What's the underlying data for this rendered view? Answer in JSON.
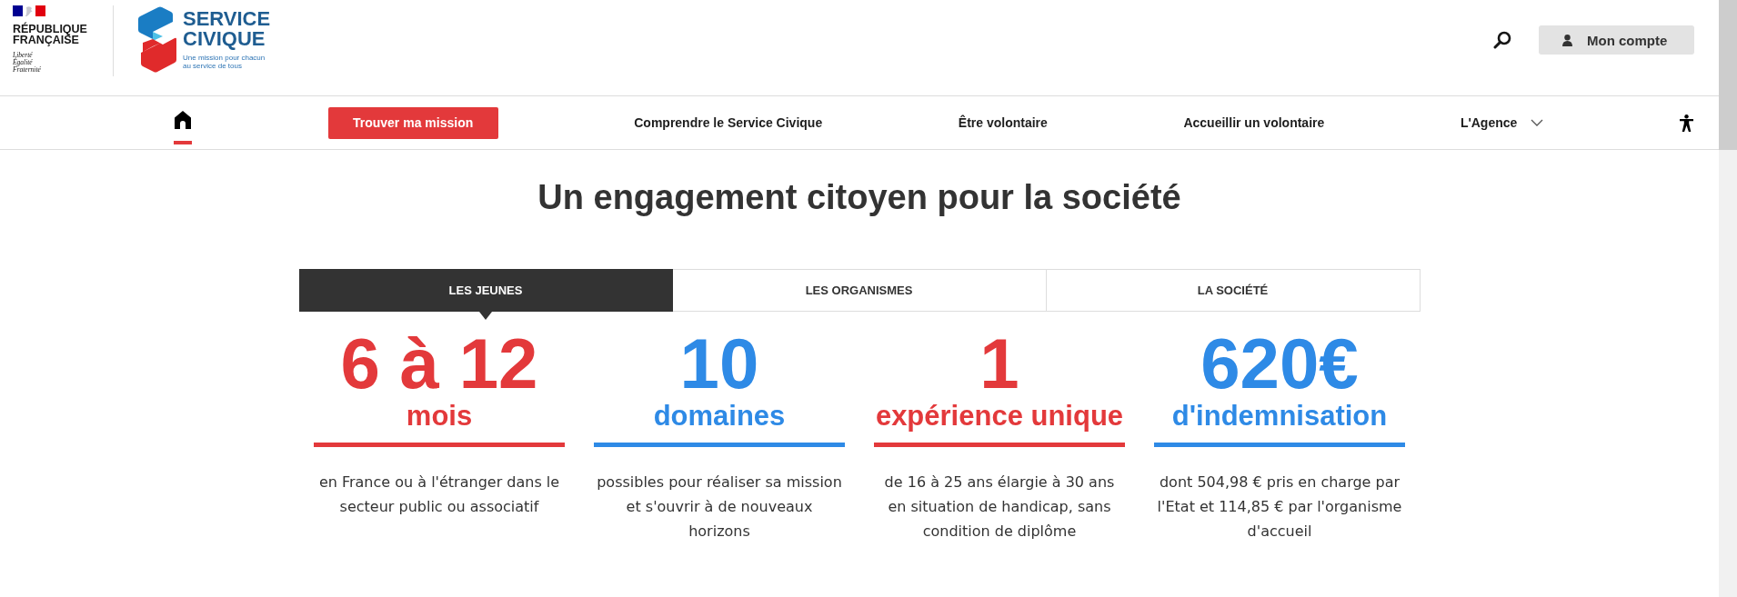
{
  "header": {
    "republic": {
      "name": "RÉPUBLIQUE FRANÇAISE",
      "motto": "Liberté Égalité Fraternité"
    },
    "brand": {
      "name": "SERVICE CIVIQUE",
      "tagline": "Une mission pour chacun au service de tous"
    },
    "account_button": {
      "label": "Mon compte"
    }
  },
  "nav": {
    "items": [
      {
        "kind": "home",
        "selected": true
      },
      {
        "kind": "button",
        "label": "Trouver ma mission",
        "selected": false
      },
      {
        "kind": "link",
        "label": "Comprendre le Service Civique",
        "selected": false
      },
      {
        "kind": "link",
        "label": "Être volontaire",
        "selected": false
      },
      {
        "kind": "link",
        "label": "Accueillir un volontaire",
        "selected": false
      },
      {
        "kind": "dropdown",
        "label": "L'Agence",
        "selected": false
      }
    ]
  },
  "main": {
    "title": "Un engagement citoyen pour la société",
    "tabs": [
      {
        "label": "LES JEUNES",
        "selected": true
      },
      {
        "label": "LES ORGANISMES",
        "selected": false
      },
      {
        "label": "LA SOCIÉTÉ",
        "selected": false
      }
    ],
    "stats": [
      {
        "value": "6 à 12",
        "unit": "mois",
        "description": "en France ou à l'étranger dans le secteur public ou associatif",
        "color": "#e3393b"
      },
      {
        "value": "10",
        "unit": "domaines",
        "description": "possibles pour réaliser sa mission et s'ouvrir à de nouveaux horizons",
        "color": "#2e8ae6"
      },
      {
        "value": "1",
        "unit": "expérience unique",
        "description": "de 16 à 25 ans élargie à 30 ans en situation de handicap, sans condition de diplôme",
        "color": "#e3393b"
      },
      {
        "value": "620€",
        "unit": "d'indemnisation",
        "description": "dont 504,98 € pris en charge par l'Etat et 114,85 € par l'organisme d'accueil",
        "color": "#2e8ae6"
      }
    ]
  }
}
